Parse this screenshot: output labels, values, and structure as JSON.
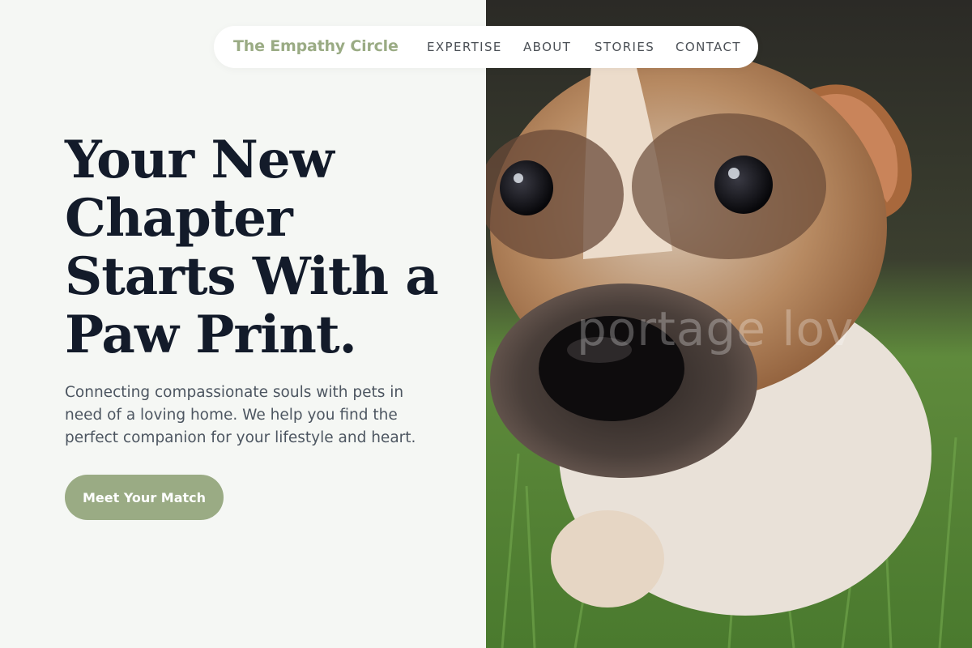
{
  "nav": {
    "brand": "The Empathy Circle",
    "links": [
      "EXPERTISE",
      "ABOUT",
      "STORIES",
      "CONTACT"
    ]
  },
  "hero": {
    "headline": "Your New Chapter Starts With a Paw Print.",
    "subtext": "Connecting compassionate souls with pets in need of a loving home. We help you find the perfect companion for your lifestyle and heart.",
    "cta_label": "Meet Your Match"
  },
  "image": {
    "subject": "close-up of puppy in grass",
    "watermark": "portage lov"
  },
  "colors": {
    "accent": "#9aab84",
    "heading": "#131b2a",
    "body_text": "#4d5661",
    "background": "#f5f7f4"
  }
}
